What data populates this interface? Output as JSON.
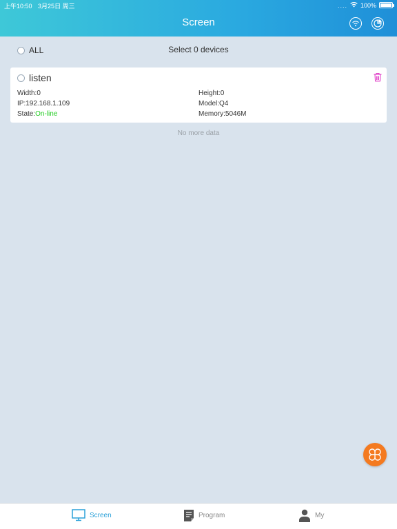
{
  "status": {
    "time": "上午10:50",
    "date": "3月25日 周三",
    "signal_dots": "....",
    "battery_text": "100%"
  },
  "header": {
    "title": "Screen"
  },
  "selection": {
    "all_label": "ALL",
    "count_text": "Select 0 devices"
  },
  "device": {
    "name": "listen",
    "width_label": "Width:",
    "width": "0",
    "height_label": "Height:",
    "height": "0",
    "ip_label": "IP:",
    "ip": "192.168.1.109",
    "model_label": "Model:",
    "model": "Q4",
    "state_label": "State:",
    "state": "On-line",
    "memory_label": "Memory:",
    "memory": "5046M"
  },
  "list_footer": "No more data",
  "tabs": [
    {
      "label": "Screen",
      "icon": "monitor-icon",
      "active": true
    },
    {
      "label": "Program",
      "icon": "document-icon",
      "active": false
    },
    {
      "label": "My",
      "icon": "person-icon",
      "active": false
    }
  ],
  "colors": {
    "accent": "#2aa0d8",
    "online": "#22cc22",
    "fab": "#f47a20",
    "delete": "#e040c8"
  }
}
